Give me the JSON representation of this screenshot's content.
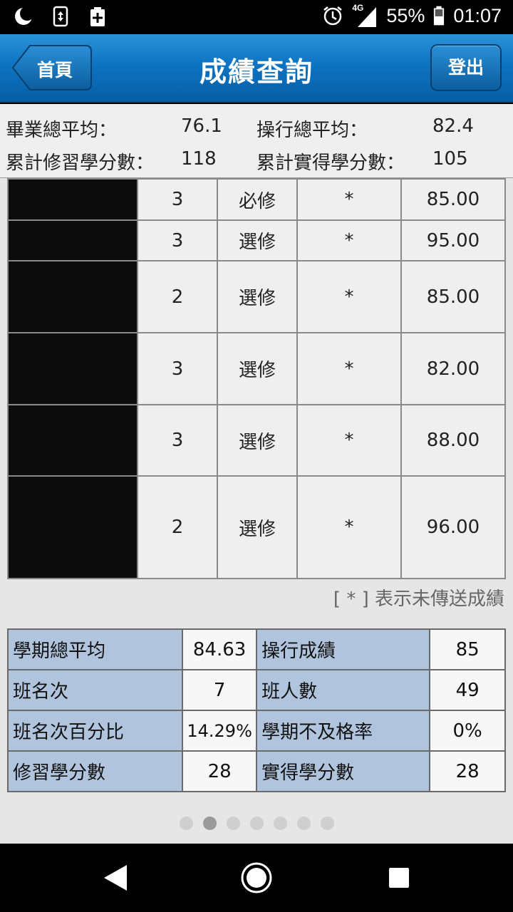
{
  "status_bar": {
    "network": "4G",
    "battery": "55%",
    "time": "01:07",
    "icons": [
      "moon-icon",
      "screen-rotate-icon",
      "battery-plus-icon",
      "alarm-icon",
      "signal-icon",
      "battery-icon"
    ]
  },
  "header": {
    "back_label": "首頁",
    "title": "成績查詢",
    "logout_label": "登出"
  },
  "summary": {
    "grad_avg_label": "畢業總平均：",
    "grad_avg_value": "76.1",
    "conduct_avg_label": "操行總平均：",
    "conduct_avg_value": "82.4",
    "credits_taken_label": "累計修習學分數：",
    "credits_taken_value": "118",
    "credits_earned_label": "累計實得學分數：",
    "credits_earned_value": "105"
  },
  "courses": [
    {
      "credits": "3",
      "type": "必修",
      "mark": "*",
      "score": "85.00"
    },
    {
      "credits": "3",
      "type": "選修",
      "mark": "*",
      "score": "95.00"
    },
    {
      "credits": "2",
      "type": "選修",
      "mark": "*",
      "score": "85.00"
    },
    {
      "credits": "3",
      "type": "選修",
      "mark": "*",
      "score": "82.00"
    },
    {
      "credits": "3",
      "type": "選修",
      "mark": "*",
      "score": "88.00"
    },
    {
      "credits": "2",
      "type": "選修",
      "mark": "*",
      "score": "96.00"
    }
  ],
  "note": "[ * ] 表示未傳送成績",
  "stats": [
    {
      "label1": "學期總平均",
      "value1": "84.63",
      "label2": "操行成績",
      "value2": "85"
    },
    {
      "label1": "班名次",
      "value1": "7",
      "label2": "班人數",
      "value2": "49"
    },
    {
      "label1": "班名次百分比",
      "value1": "14.29%",
      "label2": "學期不及格率",
      "value2": "0%"
    },
    {
      "label1": "修習學分數",
      "value1": "28",
      "label2": "實得學分數",
      "value2": "28"
    }
  ],
  "pagination": {
    "count": 7,
    "active_page": 2
  },
  "colors": {
    "header_blue": "#0d73c2",
    "stat_label_bg": "#b0c4de",
    "content_bg": "#e6e6e6"
  }
}
